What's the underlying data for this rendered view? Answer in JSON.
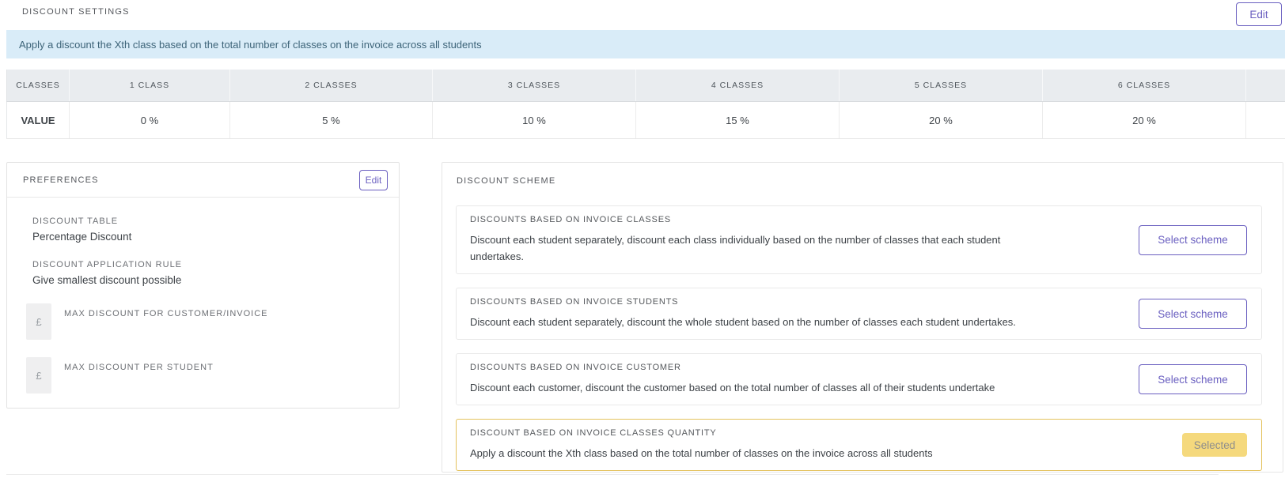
{
  "header": {
    "title": "DISCOUNT SETTINGS",
    "edit_label": "Edit"
  },
  "banner": {
    "text": "Apply a discount the Xth class based on the total number of classes on the invoice across all students"
  },
  "discount_table": {
    "row_header_column": "CLASSES",
    "value_row_label": "VALUE",
    "columns": [
      "1 CLASS",
      "2 CLASSES",
      "3 CLASSES",
      "4 CLASSES",
      "5 CLASSES",
      "6 CLASSES",
      ""
    ],
    "values": [
      "0 %",
      "5 %",
      "10 %",
      "15 %",
      "20 %",
      "20 %",
      ""
    ]
  },
  "preferences": {
    "title": "PREFERENCES",
    "edit_label": "Edit",
    "fields": [
      {
        "label": "DISCOUNT TABLE",
        "value": "Percentage Discount"
      },
      {
        "label": "DISCOUNT APPLICATION RULE",
        "value": "Give smallest discount possible"
      }
    ],
    "currency_fields": [
      {
        "prefix": "£",
        "label": "MAX DISCOUNT FOR CUSTOMER/INVOICE",
        "value": ""
      },
      {
        "prefix": "£",
        "label": "MAX DISCOUNT PER STUDENT",
        "value": ""
      }
    ]
  },
  "discount_scheme": {
    "title": "DISCOUNT SCHEME",
    "select_label": "Select scheme",
    "selected_label": "Selected",
    "schemes": [
      {
        "title": "DISCOUNTS BASED ON INVOICE CLASSES",
        "description": "Discount each student separately, discount each class individually based on the number of classes that each student undertakes.",
        "selected": false
      },
      {
        "title": "DISCOUNTS BASED ON INVOICE STUDENTS",
        "description": "Discount each student separately, discount the whole student based on the number of classes each student undertakes.",
        "selected": false
      },
      {
        "title": "DISCOUNTS BASED ON INVOICE CUSTOMER",
        "description": "Discount each customer, discount the customer based on the total number of classes all of their students undertake",
        "selected": false
      },
      {
        "title": "DISCOUNT BASED ON INVOICE CLASSES QUANTITY",
        "description": "Apply a discount the Xth class based on the total number of classes on the invoice across all students",
        "selected": true
      }
    ]
  },
  "colors": {
    "accent_purple": "#6a5fc0",
    "banner_bg": "#d9ecf8",
    "banner_text": "#3c6378",
    "table_header_bg": "#e9ecef",
    "selected_badge_bg": "#f5d97d",
    "selected_border": "#e4c25d"
  }
}
